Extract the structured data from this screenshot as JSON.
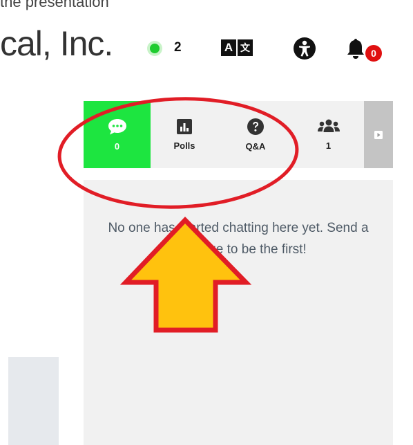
{
  "header": {
    "caption_fragment": "the presentation",
    "brand": "cal, Inc.",
    "online_count": "2",
    "translate": {
      "latin": "A",
      "cjk": "文"
    },
    "notification_count": "0"
  },
  "tabs": [
    {
      "id": "chat",
      "label": "0",
      "icon": "chat-bubble-icon"
    },
    {
      "id": "polls",
      "label": "Polls",
      "icon": "bar-chart-icon"
    },
    {
      "id": "qa",
      "label": "Q&A",
      "icon": "question-circle-icon"
    },
    {
      "id": "people",
      "label": "1",
      "icon": "users-icon"
    },
    {
      "id": "more",
      "label": "",
      "icon": "caret-right-icon"
    }
  ],
  "chat_panel": {
    "empty_message": "No one has started chatting here yet. Send a message to be the first!"
  },
  "colors": {
    "active_tab": "#1de540",
    "online": "#1fcc2f",
    "badge": "#e01010",
    "annotation_red": "#e11d26",
    "arrow_fill": "#ffc20e"
  }
}
